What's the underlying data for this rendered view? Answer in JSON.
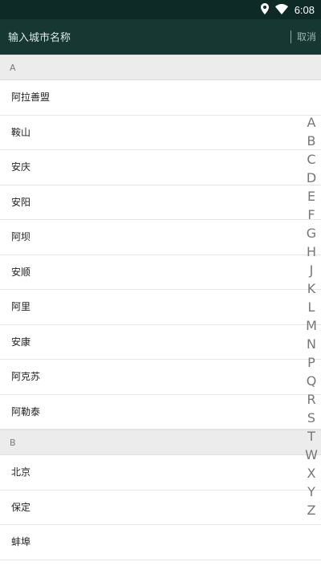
{
  "status_bar": {
    "time": "6:08",
    "icons": [
      "location-icon",
      "wifi-icon"
    ]
  },
  "search": {
    "placeholder": "输入城市名称",
    "value": "",
    "cancel_label": "取消"
  },
  "sections": [
    {
      "letter": "A",
      "cities": [
        "阿拉善盟",
        "鞍山",
        "安庆",
        "安阳",
        "阿坝",
        "安顺",
        "阿里",
        "安康",
        "阿克苏",
        "阿勒泰"
      ]
    },
    {
      "letter": "B",
      "cities": [
        "北京",
        "保定",
        "蚌埠"
      ]
    }
  ],
  "index_letters": [
    "A",
    "B",
    "C",
    "D",
    "E",
    "F",
    "G",
    "H",
    "J",
    "K",
    "L",
    "M",
    "N",
    "P",
    "Q",
    "R",
    "S",
    "T",
    "W",
    "X",
    "Y",
    "Z"
  ],
  "colors": {
    "header_bg": "#163732",
    "status_bg": "#0e2a26",
    "section_bg": "#ececec"
  }
}
